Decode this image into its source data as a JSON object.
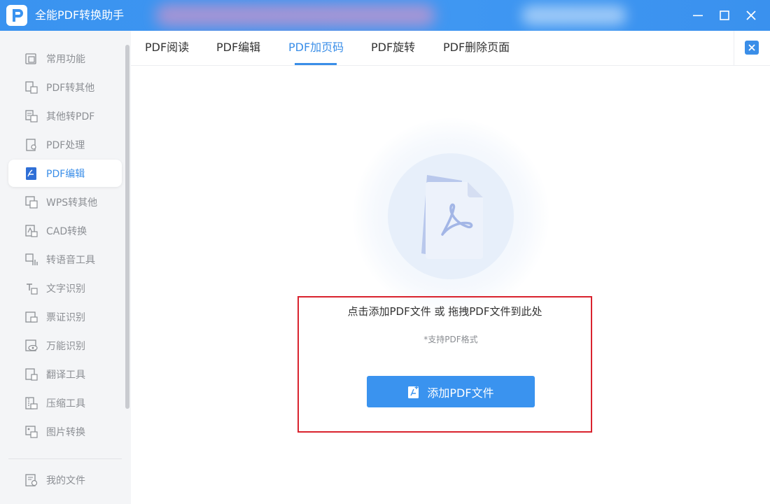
{
  "app": {
    "title": "全能PDF转换助手",
    "logo_icon": "pdf-logo-icon"
  },
  "window": {
    "controls": [
      "minimize-icon",
      "maximize-icon",
      "close-icon"
    ]
  },
  "sidebar": {
    "items": [
      {
        "label": "常用功能",
        "icon": "toolbox-icon"
      },
      {
        "label": "PDF转其他",
        "icon": "pdf-convert-icon"
      },
      {
        "label": "其他转PDF",
        "icon": "to-pdf-icon"
      },
      {
        "label": "PDF处理",
        "icon": "pdf-process-icon"
      },
      {
        "label": "PDF编辑",
        "icon": "pdf-edit-icon",
        "active": true
      },
      {
        "label": "WPS转其他",
        "icon": "wps-icon"
      },
      {
        "label": "CAD转换",
        "icon": "cad-icon"
      },
      {
        "label": "转语音工具",
        "icon": "voice-icon"
      },
      {
        "label": "文字识别",
        "icon": "text-ocr-icon"
      },
      {
        "label": "票证识别",
        "icon": "ticket-icon"
      },
      {
        "label": "万能识别",
        "icon": "eye-scan-icon"
      },
      {
        "label": "翻译工具",
        "icon": "translate-icon"
      },
      {
        "label": "压缩工具",
        "icon": "zip-icon"
      },
      {
        "label": "图片转换",
        "icon": "image-icon"
      }
    ],
    "footer_item": {
      "label": "我的文件",
      "icon": "my-files-icon"
    }
  },
  "tabs": [
    {
      "label": "PDF阅读"
    },
    {
      "label": "PDF编辑"
    },
    {
      "label": "PDF加页码",
      "active": true
    },
    {
      "label": "PDF旋转"
    },
    {
      "label": "PDF删除页面"
    }
  ],
  "drop_area": {
    "hint": "点击添加PDF文件 或 拖拽PDF文件到此处",
    "sub_hint": "*支持PDF格式",
    "button_label": "添加PDF文件"
  },
  "colors": {
    "accent": "#3a8ee8",
    "highlight_border": "#d9232e",
    "titlebar": "#3a93f0"
  }
}
